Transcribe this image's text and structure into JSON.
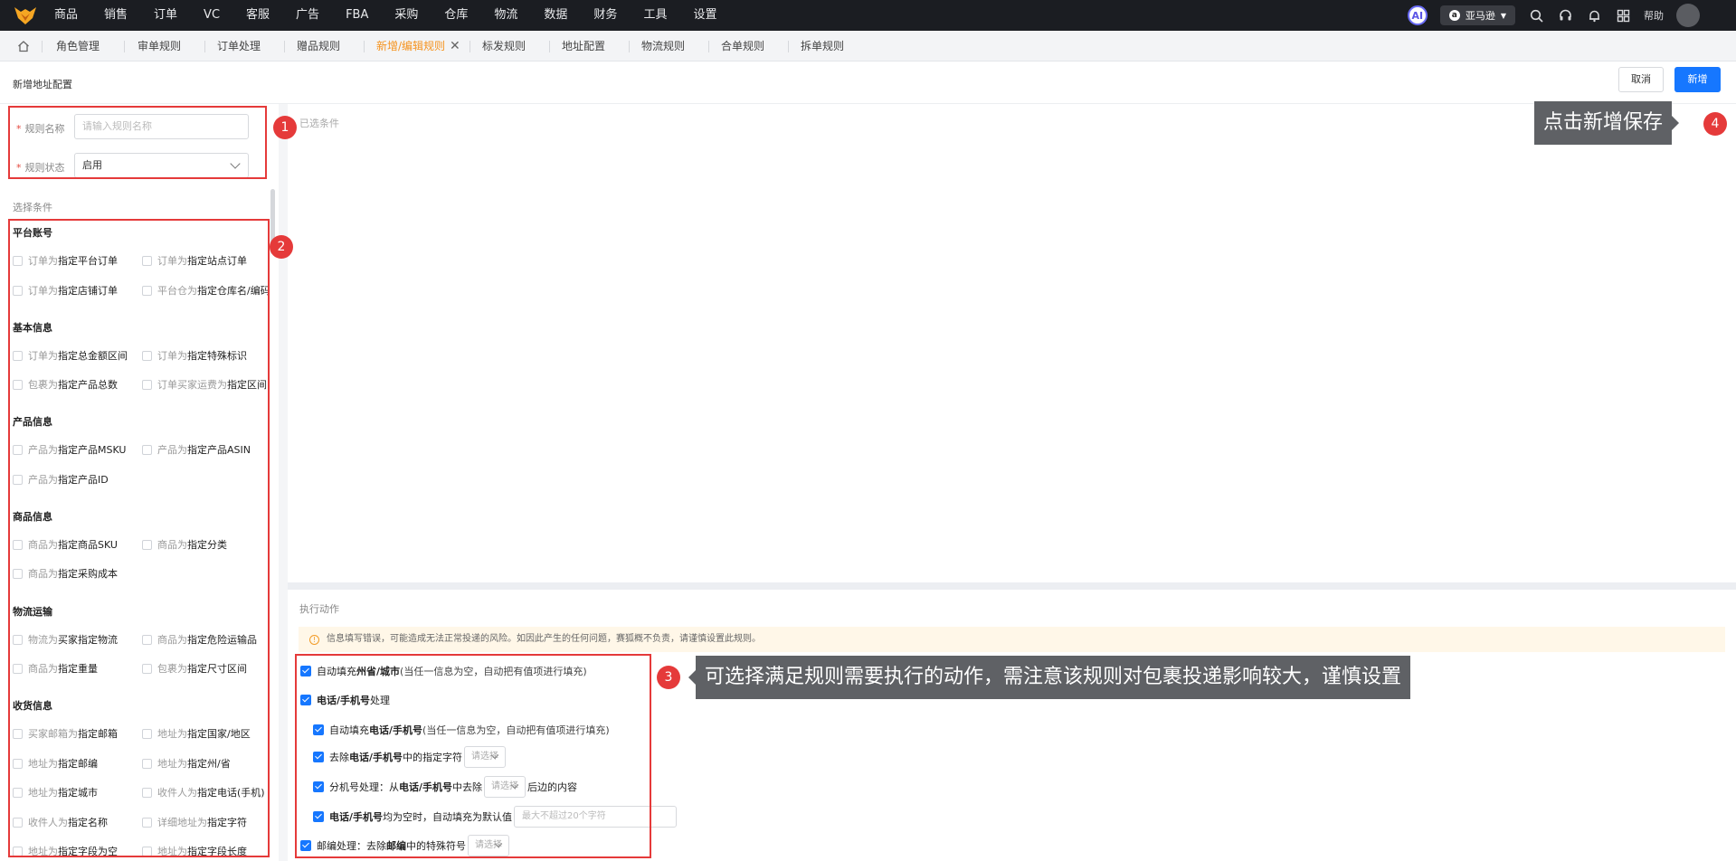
{
  "topnav": {
    "items": [
      "商品",
      "销售",
      "订单",
      "VC",
      "客服",
      "广告",
      "FBA",
      "采购",
      "仓库",
      "物流",
      "数据",
      "财务",
      "工具",
      "设置"
    ],
    "ai_label": "AI",
    "shop": "亚马逊",
    "help": "帮助"
  },
  "tabs": [
    {
      "label": "角色管理"
    },
    {
      "label": "审单规则"
    },
    {
      "label": "订单处理"
    },
    {
      "label": "赠品规则"
    },
    {
      "label": "新增/编辑规则"
    },
    {
      "label": "标发规则"
    },
    {
      "label": "地址配置"
    },
    {
      "label": "物流规则"
    },
    {
      "label": "合单规则"
    },
    {
      "label": "拆单规则"
    }
  ],
  "page": {
    "title": "新增地址配置",
    "cancel": "取消",
    "create": "新增"
  },
  "form": {
    "name_label": "规则名称",
    "name_placeholder": "请输入规则名称",
    "status_label": "规则状态",
    "status_value": "启用",
    "required_mark": "*"
  },
  "conditions": {
    "title": "选择条件",
    "selected_title": "已选条件",
    "sections": [
      {
        "title": "平台账号",
        "items": [
          [
            "订单为",
            "指定平台订单"
          ],
          [
            "订单为",
            "指定站点订单"
          ],
          [
            "订单为",
            "指定店铺订单"
          ],
          [
            "平台仓为",
            "指定仓库名/编码"
          ]
        ]
      },
      {
        "title": "基本信息",
        "items": [
          [
            "订单为",
            "指定总金额区间"
          ],
          [
            "订单为",
            "指定特殊标识"
          ],
          [
            "包裹为",
            "指定产品总数"
          ],
          [
            "订单买家运费为",
            "指定区间"
          ]
        ]
      },
      {
        "title": "产品信息",
        "items": [
          [
            "产品为",
            "指定产品MSKU"
          ],
          [
            "产品为",
            "指定产品ASIN"
          ],
          [
            "产品为",
            "指定产品ID"
          ]
        ]
      },
      {
        "title": "商品信息",
        "items": [
          [
            "商品为",
            "指定商品SKU"
          ],
          [
            "商品为",
            "指定分类"
          ],
          [
            "商品为",
            "指定采购成本"
          ]
        ]
      },
      {
        "title": "物流运输",
        "items": [
          [
            "物流为",
            "买家指定物流"
          ],
          [
            "商品为",
            "指定危险运输品"
          ],
          [
            "商品为",
            "指定重量"
          ],
          [
            "包裹为",
            "指定尺寸区间"
          ]
        ]
      },
      {
        "title": "收货信息",
        "items": [
          [
            "买家邮箱为",
            "指定邮箱"
          ],
          [
            "地址为",
            "指定国家/地区"
          ],
          [
            "地址为",
            "指定邮编"
          ],
          [
            "地址为",
            "指定州/省"
          ],
          [
            "地址为",
            "指定城市"
          ],
          [
            "收件人为",
            "指定电话(手机)"
          ],
          [
            "收件人为",
            "指定名称"
          ],
          [
            "详细地址为",
            "指定字符"
          ],
          [
            "地址为",
            "指定字段为空"
          ],
          [
            "地址为",
            "指定字段长度"
          ]
        ]
      }
    ]
  },
  "actions": {
    "title": "执行动作",
    "warning": "信息填写错误，可能造成无法正常投递的风险。如因此产生的任何问题，赛狐概不负责，请谨慎设置此规则。",
    "fill_state_pre": "自动填充",
    "fill_state_bold": "州省/城市",
    "fill_state_hint": "(当任一信息为空，自动把有值项进行填充)",
    "phone_bold": "电话/手机号",
    "phone_post": "处理",
    "auto_fill_pre": "自动填充",
    "auto_fill_bold": "电话/手机号",
    "auto_fill_hint": "(当任一信息为空，自动把有值项进行填充)",
    "remove_pre": "去除",
    "remove_bold": "电话/手机号",
    "remove_post": "中的指定字符",
    "ext_pre": "分机号处理：从",
    "ext_bold": "电话/手机号",
    "ext_mid": "中去除",
    "ext_post": "后边的内容",
    "empty_bold": "电话/手机号",
    "empty_post": "均为空时，自动填充为默认值",
    "zip_pre": "邮编处理：去除",
    "zip_bold": "邮编",
    "zip_post": "中的特殊符号",
    "select_placeholder": "请选择",
    "default_placeholder": "最大不超过20个字符"
  },
  "annotations": {
    "n1": "1",
    "n2": "2",
    "n3": "3",
    "n4": "4",
    "tip3": "可选择满足规则需要执行的动作，需注意该规则对包裹投递影响较大，谨慎设置",
    "tip4": "点击新增保存"
  }
}
